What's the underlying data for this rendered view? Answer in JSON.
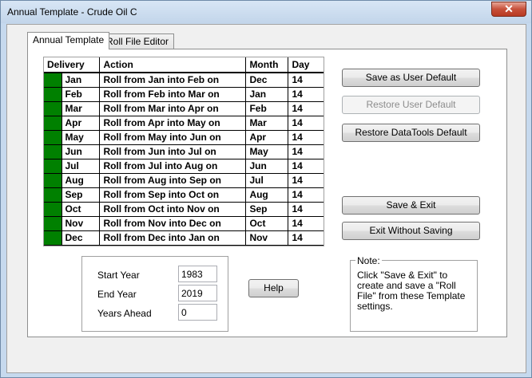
{
  "window": {
    "title": "Annual Template  -  Crude Oil C",
    "close_glyph": "✕"
  },
  "tabs": [
    {
      "label": "Annual Template",
      "active": true
    },
    {
      "label": "Roll File Editor",
      "active": false
    }
  ],
  "grid": {
    "headers": [
      "Delivery",
      "Action",
      "Month",
      "Day"
    ],
    "swatch_color": "#008000",
    "rows": [
      {
        "delivery": "Jan",
        "action": "Roll from Jan into Feb on",
        "month": "Dec",
        "day": "14"
      },
      {
        "delivery": "Feb",
        "action": "Roll from Feb into Mar on",
        "month": "Jan",
        "day": "14"
      },
      {
        "delivery": "Mar",
        "action": "Roll from Mar into Apr on",
        "month": "Feb",
        "day": "14"
      },
      {
        "delivery": "Apr",
        "action": "Roll from Apr into May on",
        "month": "Mar",
        "day": "14"
      },
      {
        "delivery": "May",
        "action": "Roll from May into Jun on",
        "month": "Apr",
        "day": "14"
      },
      {
        "delivery": "Jun",
        "action": "Roll from Jun into Jul on",
        "month": "May",
        "day": "14"
      },
      {
        "delivery": "Jul",
        "action": "Roll from Jul into Aug on",
        "month": "Jun",
        "day": "14"
      },
      {
        "delivery": "Aug",
        "action": "Roll from Aug into Sep on",
        "month": "Jul",
        "day": "14"
      },
      {
        "delivery": "Sep",
        "action": "Roll from Sep into Oct on",
        "month": "Aug",
        "day": "14"
      },
      {
        "delivery": "Oct",
        "action": "Roll from Oct into Nov on",
        "month": "Sep",
        "day": "14"
      },
      {
        "delivery": "Nov",
        "action": "Roll from Nov into Dec on",
        "month": "Oct",
        "day": "14"
      },
      {
        "delivery": "Dec",
        "action": "Roll from Dec into Jan on",
        "month": "Nov",
        "day": "14"
      }
    ]
  },
  "buttons": {
    "save_user_default": "Save as User Default",
    "restore_user_default": "Restore User Default",
    "restore_datatools_default": "Restore DataTools Default",
    "save_exit": "Save & Exit",
    "exit_without_saving": "Exit Without Saving",
    "help": "Help"
  },
  "years": {
    "start_label": "Start Year",
    "start_value": "1983",
    "end_label": "End Year",
    "end_value": "2019",
    "ahead_label": "Years Ahead",
    "ahead_value": "0"
  },
  "note": {
    "legend": "Note:",
    "text": "Click \"Save & Exit\" to create and save a \"Roll File\" from these Template settings."
  }
}
